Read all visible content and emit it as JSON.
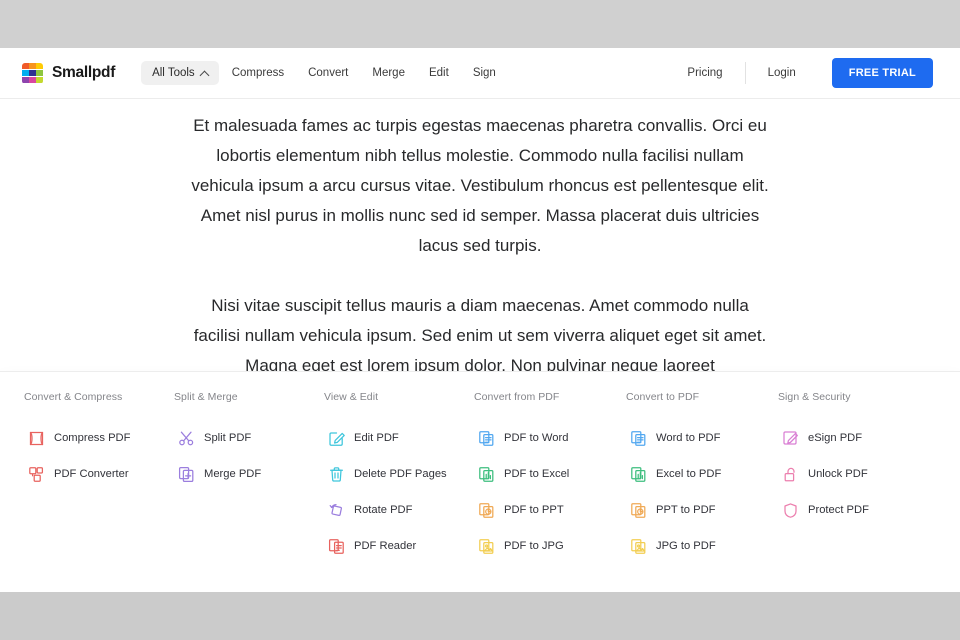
{
  "brand": {
    "name": "Smallpdf",
    "logo_colors": [
      "#F05A28",
      "#F7941E",
      "#FFCB05",
      "#00AEEF",
      "#2E3192",
      "#8DC63F",
      "#8E44AD",
      "#D946A0",
      "#C4D92E"
    ]
  },
  "header": {
    "nav": [
      {
        "label": "All Tools",
        "type": "pill",
        "icon": "chevron-up-icon",
        "open": true
      },
      {
        "label": "Compress",
        "type": "link"
      },
      {
        "label": "Convert",
        "type": "link"
      },
      {
        "label": "Merge",
        "type": "link"
      },
      {
        "label": "Edit",
        "type": "link"
      },
      {
        "label": "Sign",
        "type": "link"
      }
    ],
    "pricing_label": "Pricing",
    "login_label": "Login",
    "trial_label": "FREE TRIAL",
    "accent_color": "#1E6BF0"
  },
  "content": {
    "paragraph_1": "Et malesuada fames ac turpis egestas maecenas pharetra convallis. Orci eu lobortis elementum nibh tellus molestie. Commodo nulla facilisi nullam vehicula ipsum a arcu cursus vitae. Vestibulum rhoncus est pellentesque elit. Amet nisl purus in mollis nunc sed id semper. Massa placerat duis ultricies lacus sed turpis.",
    "paragraph_2": "Nisi vitae suscipit tellus mauris a diam maecenas. Amet commodo nulla facilisi nullam vehicula ipsum. Sed enim ut sem viverra aliquet eget sit amet. Magna eget est lorem ipsum dolor. Non pulvinar neque laoreet"
  },
  "mega_menu": {
    "columns": [
      {
        "title": "Convert & Compress",
        "items": [
          {
            "label": "Compress PDF",
            "icon": "compress-icon",
            "color": "#E8635F"
          },
          {
            "label": "PDF Converter",
            "icon": "pdf-converter-icon",
            "color": "#E8635F"
          }
        ]
      },
      {
        "title": "Split & Merge",
        "items": [
          {
            "label": "Split PDF",
            "icon": "scissors-icon",
            "color": "#9B7EDE"
          },
          {
            "label": "Merge PDF",
            "icon": "merge-icon",
            "color": "#9B7EDE"
          }
        ]
      },
      {
        "title": "View & Edit",
        "items": [
          {
            "label": "Edit PDF",
            "icon": "edit-pencil-icon",
            "color": "#3FC6DC"
          },
          {
            "label": "Delete PDF Pages",
            "icon": "trash-icon",
            "color": "#3FC6DC"
          },
          {
            "label": "Rotate PDF",
            "icon": "rotate-icon",
            "color": "#9B7EDE"
          },
          {
            "label": "PDF Reader",
            "icon": "reader-icon",
            "color": "#E8635F"
          }
        ]
      },
      {
        "title": "Convert from PDF",
        "items": [
          {
            "label": "PDF to Word",
            "icon": "word-doc-icon",
            "color": "#51A7F0"
          },
          {
            "label": "PDF to Excel",
            "icon": "excel-doc-icon",
            "color": "#3DBE7E"
          },
          {
            "label": "PDF to PPT",
            "icon": "ppt-doc-icon",
            "color": "#F0A955"
          },
          {
            "label": "PDF to JPG",
            "icon": "jpg-doc-icon",
            "color": "#F2CE52"
          }
        ]
      },
      {
        "title": "Convert to PDF",
        "items": [
          {
            "label": "Word to PDF",
            "icon": "word-doc-icon",
            "color": "#51A7F0"
          },
          {
            "label": "Excel to PDF",
            "icon": "excel-doc-icon",
            "color": "#3DBE7E"
          },
          {
            "label": "PPT to PDF",
            "icon": "ppt-doc-icon",
            "color": "#F0A955"
          },
          {
            "label": "JPG to PDF",
            "icon": "jpg-doc-icon",
            "color": "#F2CE52"
          }
        ]
      },
      {
        "title": "Sign & Security",
        "items": [
          {
            "label": "eSign PDF",
            "icon": "esign-icon",
            "color": "#D97FD4"
          },
          {
            "label": "Unlock PDF",
            "icon": "unlock-icon",
            "color": "#EC7FAE"
          },
          {
            "label": "Protect PDF",
            "icon": "shield-icon",
            "color": "#EC7FAE"
          }
        ]
      }
    ]
  }
}
